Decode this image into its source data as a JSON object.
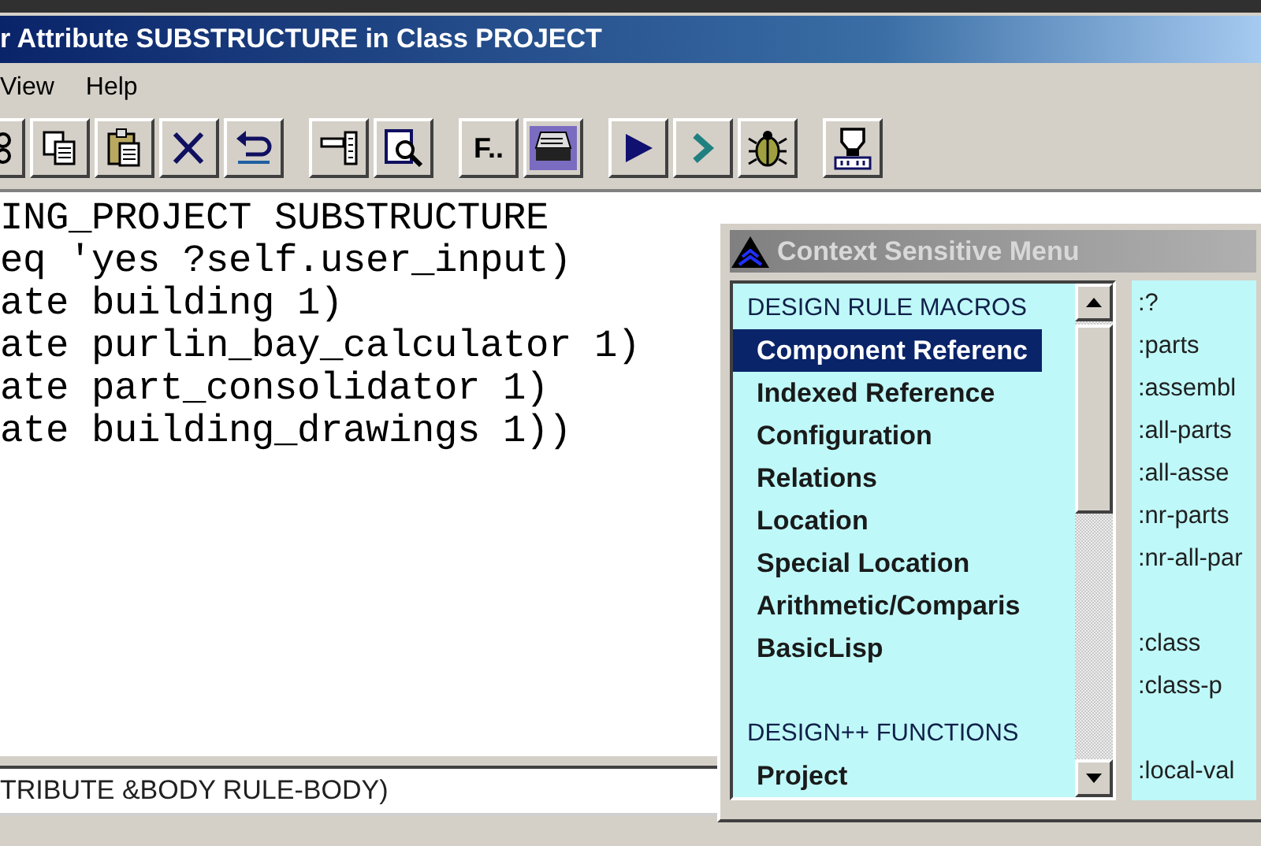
{
  "window": {
    "title": "r Attribute SUBSTRUCTURE in Class PROJECT"
  },
  "menu": [
    "View",
    "Help"
  ],
  "toolbar_groups": [
    [
      {
        "kind": "icon"
      },
      {
        "kind": "icon"
      },
      {
        "kind": "icon"
      },
      {
        "kind": "icon"
      },
      {
        "kind": "icon"
      }
    ],
    [
      {
        "kind": "icon"
      },
      {
        "kind": "icon"
      }
    ],
    [
      {
        "kind": "text",
        "label": "F.."
      },
      {
        "kind": "icon"
      }
    ],
    [
      {
        "kind": "icon"
      },
      {
        "kind": "icon"
      },
      {
        "kind": "icon"
      }
    ],
    [
      {
        "kind": "icon"
      }
    ]
  ],
  "editor": {
    "lines": [
      "ING_PROJECT SUBSTRUCTURE",
      "eq 'yes ?self.user_input)",
      "ate building 1)",
      "ate purlin_bay_calculator 1)",
      "ate part_consolidator 1)",
      "ate building_drawings 1))"
    ]
  },
  "status_field": {
    "value": "TRIBUTE &BODY RULE-BODY)"
  },
  "context_menu": {
    "title": "Context Sensitive Menu",
    "groups": [
      {
        "heading": "DESIGN RULE MACROS",
        "items": [
          {
            "label": "Component Referenc",
            "selected": true
          },
          {
            "label": "Indexed Reference",
            "selected": false
          },
          {
            "label": "Configuration",
            "selected": false
          },
          {
            "label": "Relations",
            "selected": false
          },
          {
            "label": "Location",
            "selected": false
          },
          {
            "label": "Special Location",
            "selected": false
          },
          {
            "label": "Arithmetic/Comparis",
            "selected": false
          },
          {
            "label": "BasicLisp",
            "selected": false
          }
        ]
      },
      {
        "heading": "DESIGN++ FUNCTIONS",
        "items": [
          {
            "label": "Project",
            "selected": false
          }
        ]
      }
    ],
    "keywords": [
      [
        ":?",
        ":parts",
        ":assembl",
        ":all-parts",
        ":all-asse",
        ":nr-parts",
        ":nr-all-par"
      ],
      [
        ":class",
        ":class-p"
      ],
      [
        ":local-val"
      ]
    ]
  }
}
